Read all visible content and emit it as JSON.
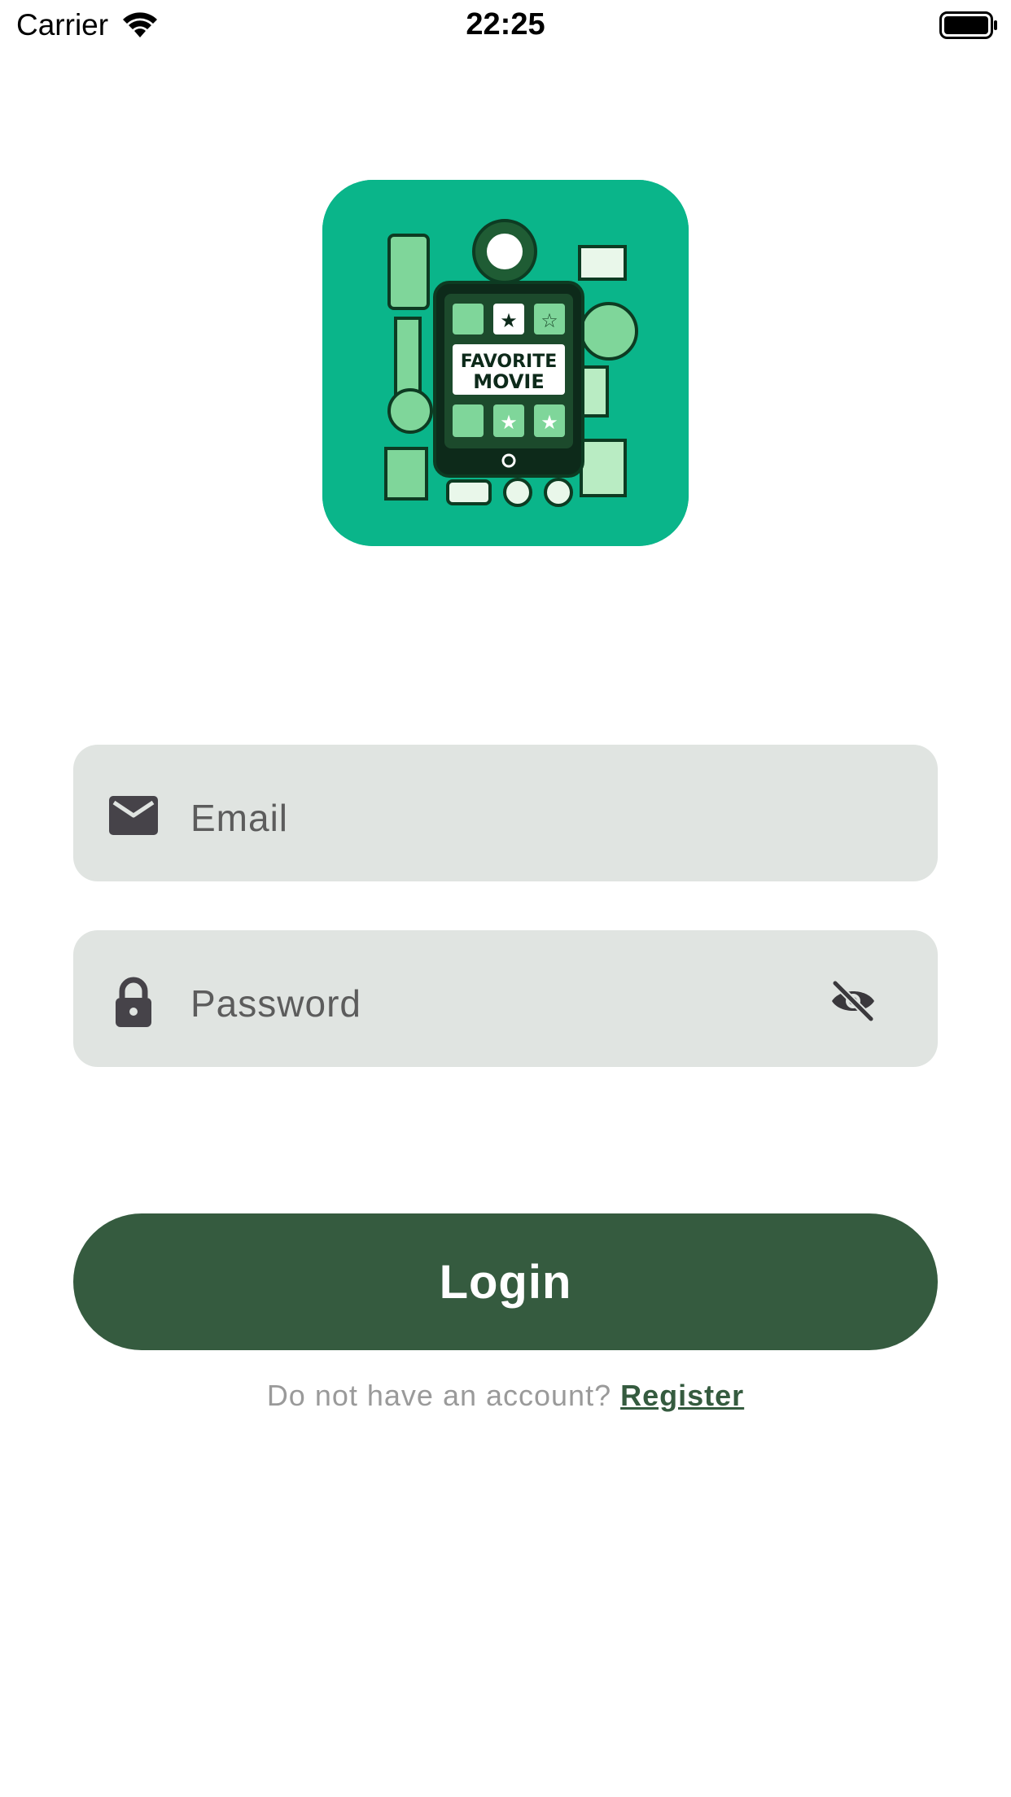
{
  "status_bar": {
    "carrier": "Carrier",
    "time": "22:25",
    "icons": [
      "wifi-icon",
      "battery-icon"
    ]
  },
  "logo": {
    "text_line1": "FAVORITE",
    "text_line2": "MOVIE",
    "background_color": "#0ab58a"
  },
  "form": {
    "email": {
      "placeholder": "Email",
      "value": "",
      "icon": "envelope-icon"
    },
    "password": {
      "placeholder": "Password",
      "value": "",
      "icon": "lock-icon",
      "toggle_icon": "eye-slash-icon"
    },
    "login_label": "Login",
    "register_prompt": "Do not have an account?",
    "register_link": "Register"
  },
  "colors": {
    "primary": "#355b3f",
    "field_background": "#e0e4e1",
    "prompt_text": "#9a9a9a"
  }
}
